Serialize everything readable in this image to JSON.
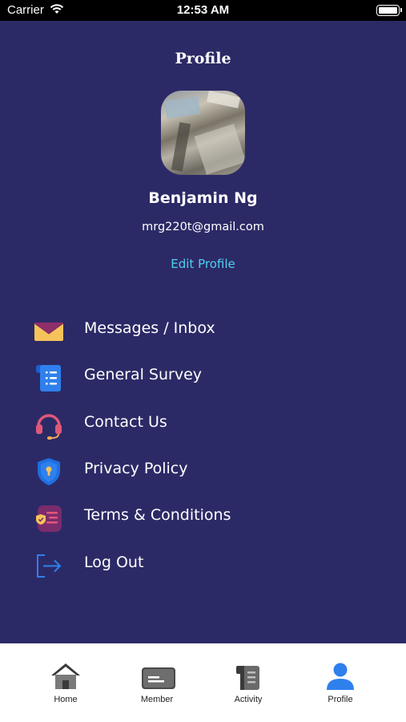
{
  "status_bar": {
    "carrier": "Carrier",
    "time": "12:53 AM"
  },
  "header": {
    "title": "Profile"
  },
  "profile": {
    "name": "Benjamin Ng",
    "email": "mrg220t@gmail.com",
    "edit_label": "Edit Profile"
  },
  "menu": {
    "items": [
      {
        "label": "Messages / Inbox",
        "icon": "envelope-icon"
      },
      {
        "label": "General Survey",
        "icon": "document-icon"
      },
      {
        "label": "Contact Us",
        "icon": "headset-icon"
      },
      {
        "label": "Privacy Policy",
        "icon": "shield-lock-icon"
      },
      {
        "label": "Terms & Conditions",
        "icon": "terms-icon"
      },
      {
        "label": "Log Out",
        "icon": "logout-icon"
      }
    ]
  },
  "tab_bar": {
    "tabs": [
      {
        "label": "Home",
        "icon": "house-icon"
      },
      {
        "label": "Member",
        "icon": "member-card-icon"
      },
      {
        "label": "Activity",
        "icon": "activity-book-icon"
      },
      {
        "label": "Profile",
        "icon": "person-icon"
      }
    ],
    "active_index": 3
  },
  "colors": {
    "background": "#2c2a66",
    "accent": "#4fd1f0",
    "active_tab": "#2f80ed"
  }
}
